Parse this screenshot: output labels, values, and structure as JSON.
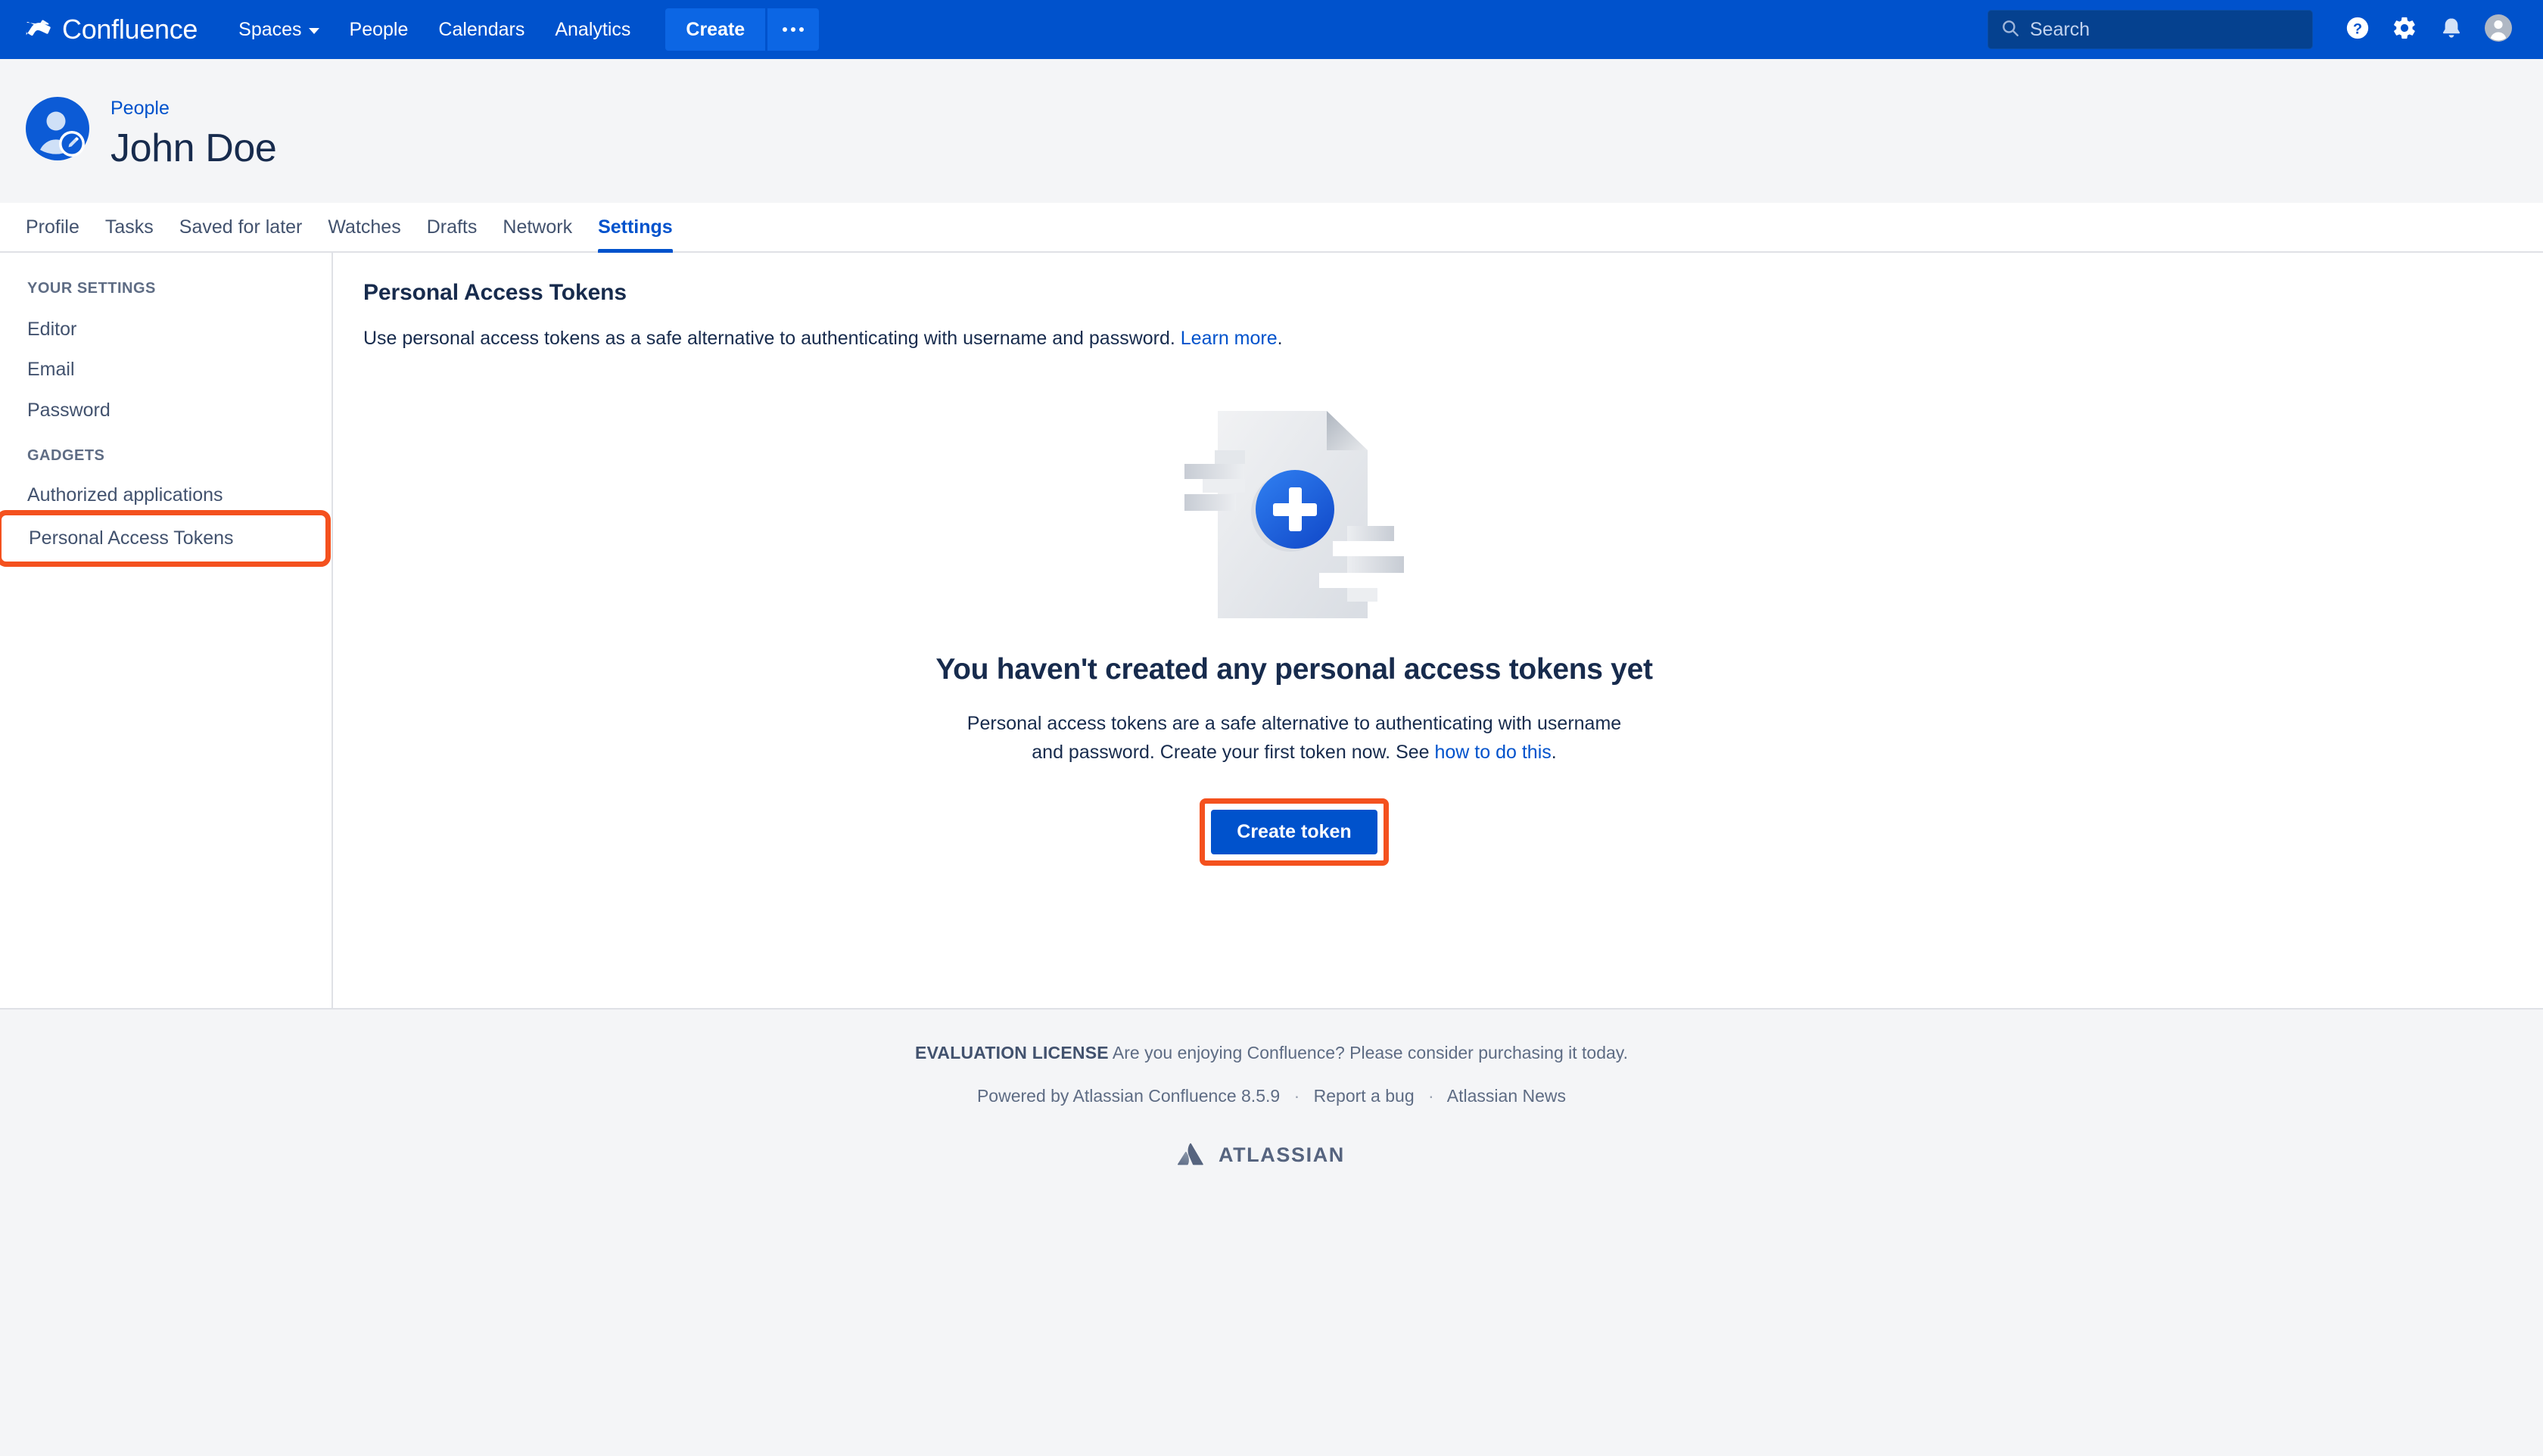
{
  "topnav": {
    "brand": "Confluence",
    "brand_icon": "confluence-logo-icon",
    "items": [
      {
        "label": "Spaces",
        "has_caret": true
      },
      {
        "label": "People",
        "has_caret": false
      },
      {
        "label": "Calendars",
        "has_caret": false
      },
      {
        "label": "Analytics",
        "has_caret": false
      }
    ],
    "create_label": "Create",
    "more_label": "…",
    "search_placeholder": "Search",
    "icons": [
      "search-icon",
      "help-icon",
      "settings-gear-icon",
      "notifications-bell-icon",
      "user-avatar-icon"
    ]
  },
  "profile": {
    "breadcrumb": "People",
    "name": "John Doe",
    "avatar_icon": "user-profile-avatar-icon",
    "avatar_badge_icon": "pencil-edit-badge-icon"
  },
  "tabs": [
    {
      "label": "Profile",
      "active": false
    },
    {
      "label": "Tasks",
      "active": false
    },
    {
      "label": "Saved for later",
      "active": false
    },
    {
      "label": "Watches",
      "active": false
    },
    {
      "label": "Drafts",
      "active": false
    },
    {
      "label": "Network",
      "active": false
    },
    {
      "label": "Settings",
      "active": true
    }
  ],
  "sidebar": {
    "group1_label": "YOUR SETTINGS",
    "group1_items": [
      {
        "label": "Editor"
      },
      {
        "label": "Email"
      },
      {
        "label": "Password"
      }
    ],
    "group2_label": "GADGETS",
    "group2_items": [
      {
        "label": "Authorized applications"
      },
      {
        "label": "Personal Access Tokens"
      }
    ],
    "highlighted_item": "Personal Access Tokens"
  },
  "content": {
    "title": "Personal Access Tokens",
    "subtitle_text": "Use personal access tokens as a safe alternative to authenticating with username and password. ",
    "subtitle_link": "Learn more",
    "subtitle_tail": ".",
    "empty_title": "You haven't created any personal access tokens yet",
    "empty_desc_text": "Personal access tokens are a safe alternative to authenticating with username and password. Create your first token now. See ",
    "empty_desc_link": "how to do this",
    "empty_desc_tail": ".",
    "cta_label": "Create token",
    "illustration_icon": "document-with-plus-illustration"
  },
  "footer": {
    "eval_label": "EVALUATION LICENSE",
    "eval_text": " Are you enjoying Confluence? Please consider purchasing it today.",
    "powered_by": "Powered by Atlassian Confluence 8.5.9",
    "report_bug": "Report a bug",
    "atlassian_news": "Atlassian News",
    "separator": "·",
    "logo_text": "ATLASSIAN",
    "logo_icon": "atlassian-logo-icon"
  },
  "colors": {
    "nav_blue": "#0052cc",
    "accent_blue": "#0c66e4",
    "highlight_orange": "#f4511e",
    "text_dark": "#172b4d",
    "text_muted": "#5e6c84",
    "page_bg": "#f4f5f7"
  }
}
